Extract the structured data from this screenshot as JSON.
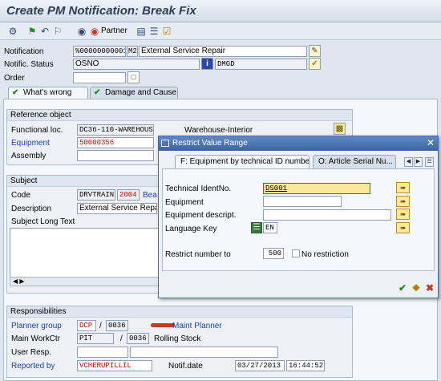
{
  "window": {
    "title": "Create PM Notification: Break Fix"
  },
  "toolbar": {
    "partner_label": "Partner"
  },
  "header": {
    "notification_label": "Notification",
    "notification_value": "%00000000001",
    "notification_type": "M2",
    "notification_text": "External Service Repair",
    "status_label": "Notific. Status",
    "status_value": "OSNO",
    "status_value2": "DMGD",
    "order_label": "Order",
    "order_value": ""
  },
  "tabs": [
    {
      "label": "What's wrong"
    },
    {
      "label": "Damage and Cause"
    }
  ],
  "reference": {
    "title": "Reference object",
    "func_loc_label": "Functional loc.",
    "func_loc_value": "DC36-110-WAREHOUSE",
    "func_loc_desc": "Warehouse-Interior",
    "equipment_label": "Equipment",
    "equipment_value": "50000356",
    "assembly_label": "Assembly",
    "assembly_value": ""
  },
  "subject": {
    "title": "Subject",
    "code_label": "Code",
    "code_value": "DRVTRAIN",
    "code_num": "2004",
    "code_desc": "Bea",
    "description_label": "Description",
    "description_value": "External Service Repair",
    "long_text_label": "Subject Long Text"
  },
  "responsibilities": {
    "title": "Responsibilities",
    "planner_label": "Planner group",
    "planner_value": "DCP",
    "planner_plant": "0036",
    "planner_desc": "Maint Planner",
    "workctr_label": "Main WorkCtr",
    "workctr_value": "PIT",
    "workctr_plant": "0036",
    "workctr_desc": "Rolling Stock",
    "user_resp_label": "User Resp.",
    "reported_label": "Reported by",
    "reported_value": "VCHERUPILLIL",
    "notif_date_label": "Notif.date",
    "notif_date_value": "03/27/2013",
    "notif_time_value": "16:44:52"
  },
  "dialog": {
    "title": "Restrict Value Range",
    "tab1": "F: Equipment by technical ID number",
    "tab2": "O: Article Serial Nu...",
    "tech_id_label": "Technical IdentNo.",
    "tech_id_value": "DS001",
    "equipment_label": "Equipment",
    "equip_desc_label": "Equipment descript.",
    "language_label": "Language Key",
    "language_value": "EN",
    "restrict_label": "Restrict number to",
    "restrict_value": "500",
    "no_restriction_label": "No restriction"
  }
}
